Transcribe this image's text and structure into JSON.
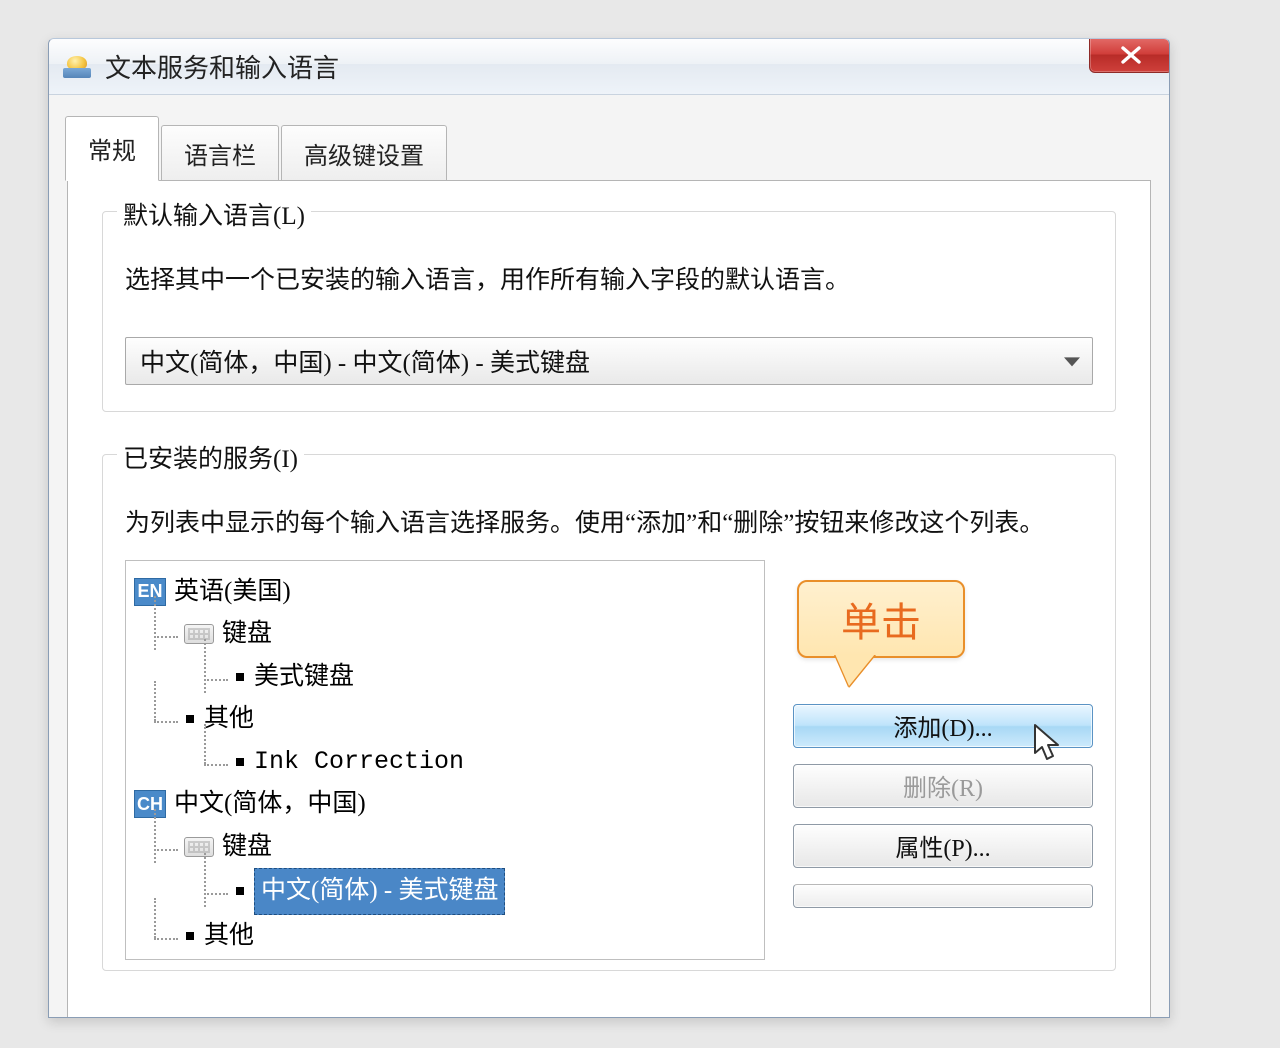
{
  "window": {
    "title": "文本服务和输入语言"
  },
  "tabs": {
    "general": "常规",
    "langbar": "语言栏",
    "advanced": "高级键设置"
  },
  "default_lang": {
    "legend": "默认输入语言(L)",
    "desc": "选择其中一个已安装的输入语言，用作所有输入字段的默认语言。",
    "selected": "中文(简体，中国) - 中文(简体) - 美式键盘"
  },
  "installed": {
    "legend": "已安装的服务(I)",
    "desc": "为列表中显示的每个输入语言选择服务。使用“添加”和“删除”按钮来修改这个列表。",
    "tree": {
      "en_badge": "EN",
      "en_label": "英语(美国)",
      "en_keyboard_group": "键盘",
      "en_us_keyboard": "美式键盘",
      "en_other_group": "其他",
      "en_ink": "Ink Correction",
      "ch_badge": "CH",
      "ch_label": "中文(简体，中国)",
      "ch_keyboard_group": "键盘",
      "ch_selected_leaf": "中文(简体) - 美式键盘",
      "ch_other_group": "其他"
    },
    "buttons": {
      "add": "添加(D)...",
      "remove": "删除(R)",
      "properties": "属性(P)..."
    }
  },
  "callout": {
    "text": "单击"
  }
}
